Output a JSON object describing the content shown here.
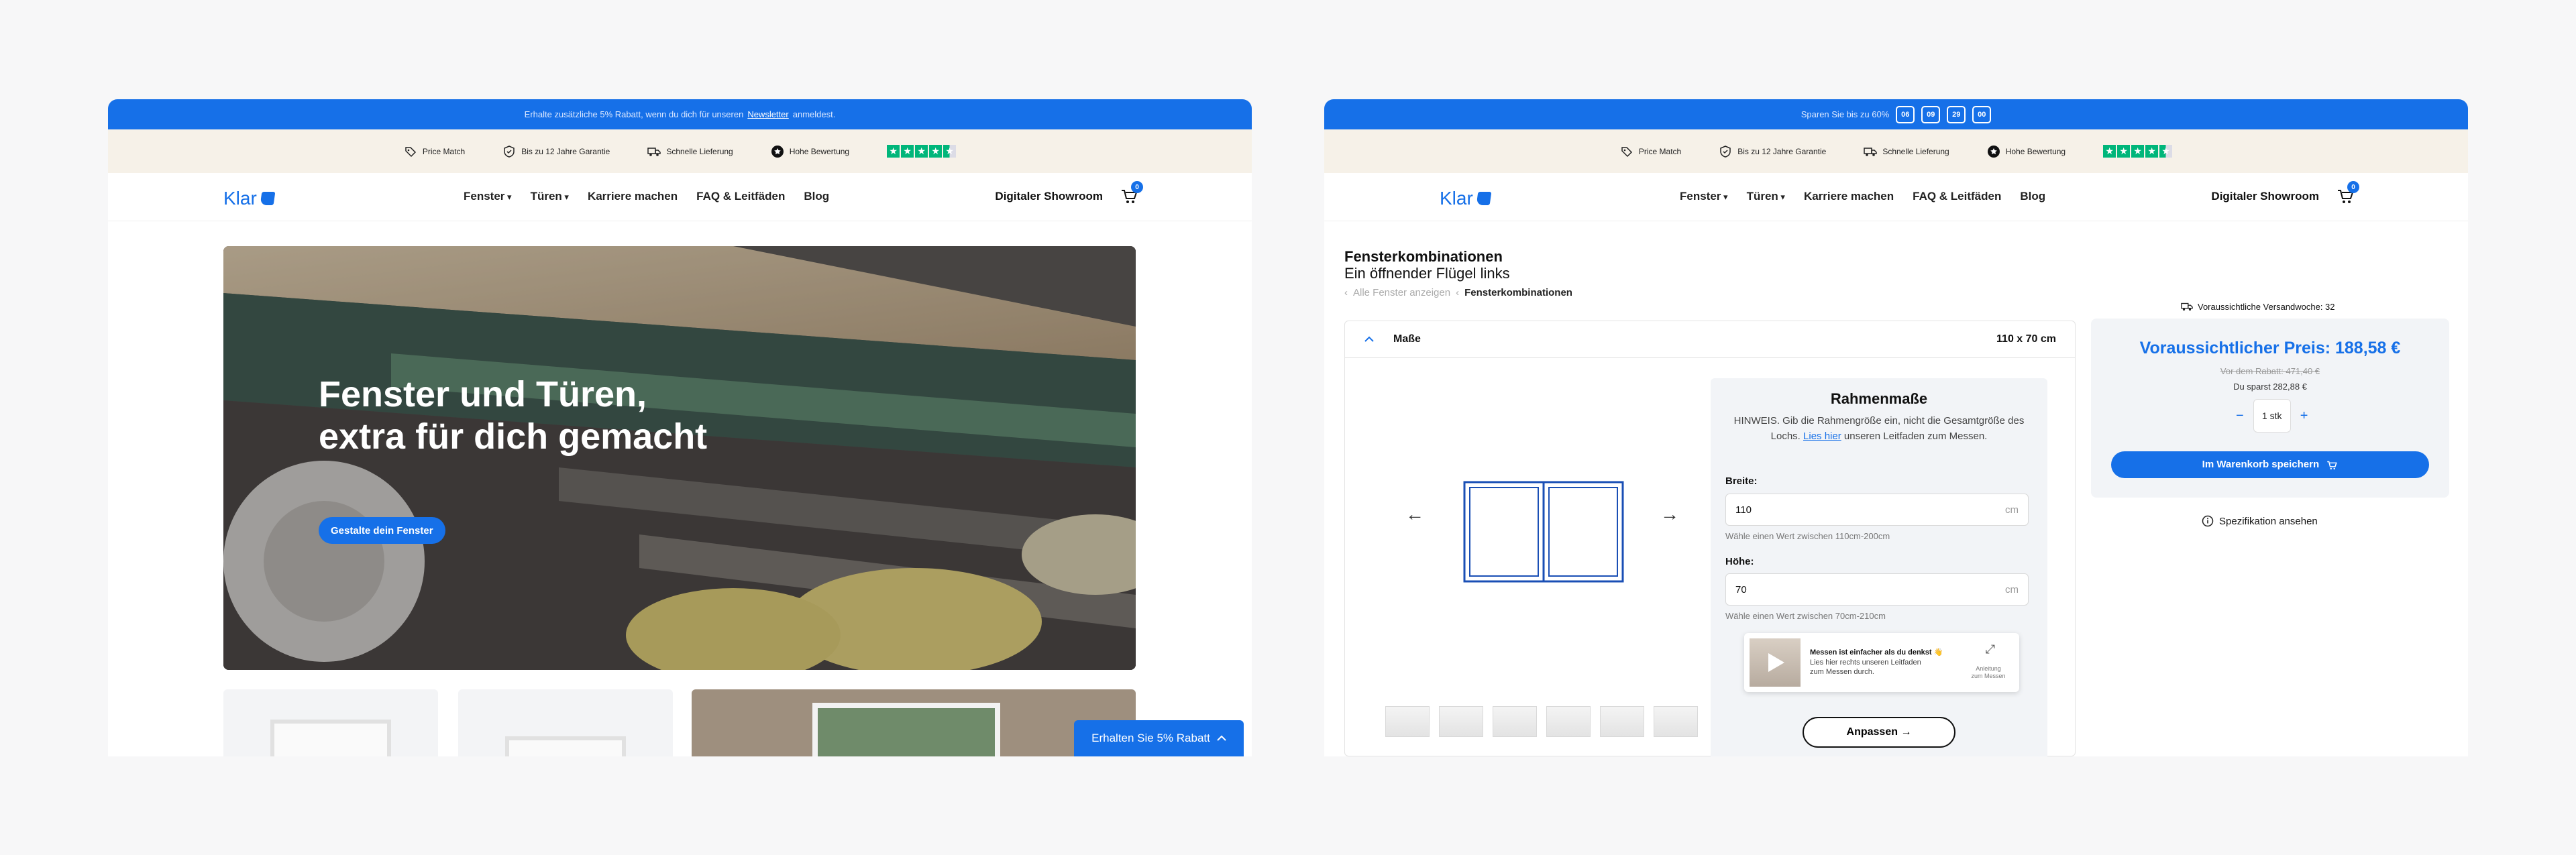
{
  "left": {
    "promo": {
      "text": "Erhalte zusätzliche 5% Rabatt, wenn du dich für unseren",
      "link": "Newsletter",
      "suffix": "anmeldest."
    },
    "trust": [
      "Price Match",
      "Bis zu 12 Jahre Garantie",
      "Schnelle Lieferung",
      "Hohe Bewertung"
    ],
    "rating": {
      "stars": 4.5,
      "color": "#00b67a"
    },
    "nav": {
      "logo": "Klar",
      "menu": [
        "Fenster",
        "Türen",
        "Karriere machen",
        "FAQ & Leitfäden",
        "Blog"
      ],
      "showroom": "Digitaler Showroom",
      "cart_count": "0"
    },
    "hero": {
      "title": "Fenster und Türen, extra für dich gemacht",
      "cta": "Gestalte dein Fenster"
    },
    "discount_tab": "Erhalten Sie 5% Rabatt"
  },
  "right": {
    "promo": {
      "text": "Sparen Sie bis zu 60%",
      "countdown": [
        "06",
        "09",
        "29",
        "00"
      ]
    },
    "trust": [
      "Price Match",
      "Bis zu 12 Jahre Garantie",
      "Schnelle Lieferung",
      "Hohe Bewertung"
    ],
    "nav": {
      "logo": "Klar",
      "menu": [
        "Fenster",
        "Türen",
        "Karriere machen",
        "FAQ & Leitfäden",
        "Blog"
      ],
      "showroom": "Digitaler Showroom",
      "cart_count": "0"
    },
    "product": {
      "title": "Fensterkombinationen",
      "subtitle": "Ein öffnender Flügel links"
    },
    "breadcrumb": {
      "back": "Alle Fenster anzeigen",
      "current": "Fensterkombinationen"
    },
    "accordion": {
      "label": "Maße",
      "value": "110 x 70 cm"
    },
    "dimensions": {
      "title": "Rahmenmaße",
      "hint_pre": "HINWEIS. Gib die Rahmengröße ein, nicht die Gesamtgröße des Lochs.",
      "hint_link": "Lies hier",
      "hint_post": "unseren Leitfaden zum Messen.",
      "width_label": "Breite:",
      "width_value": "110",
      "width_unit": "cm",
      "width_note": "Wähle einen Wert zwischen 110cm-200cm",
      "height_label": "Höhe:",
      "height_value": "70",
      "height_unit": "cm",
      "height_note": "Wähle einen Wert zwischen 70cm-210cm"
    },
    "video": {
      "title": "Messen ist einfacher als du denkst 👋",
      "desc": "Lies hier rechts unseren Leitfaden zum Messen durch.",
      "side": "Anleitung zum Messen"
    },
    "adjust": "Anpassen →",
    "shipping": "Voraussichtliche Versandwoche: 32",
    "price": {
      "label": "Voraussichtlicher Preis: 188,58 €",
      "old": "Vor dem Rabatt: 471,40 €",
      "save": "Du sparst 282,88 €",
      "qty": "1 stk"
    },
    "add_to_cart": "Im Warenkorb speichern",
    "spec": "Spezifikation ansehen"
  }
}
